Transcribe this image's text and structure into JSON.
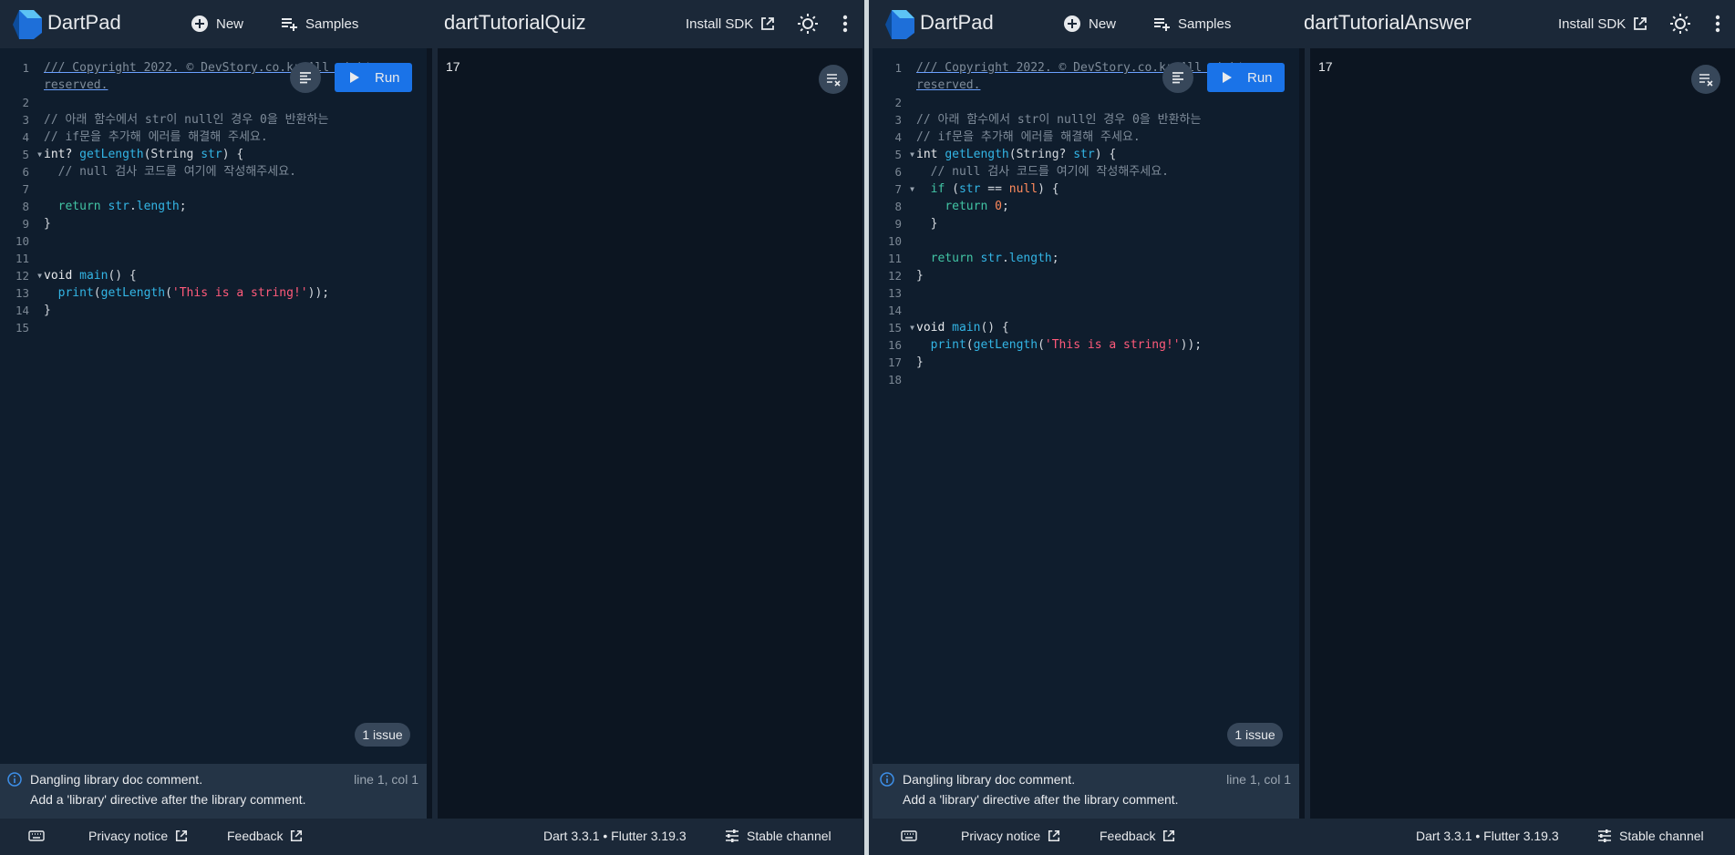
{
  "colors": {
    "accent": "#1a73e8",
    "background": "#0c1521",
    "toolbar": "#1b2838",
    "editor": "#0f1d2d"
  },
  "panes": [
    {
      "brand": "DartPad",
      "new_label": "New",
      "samples_label": "Samples",
      "title": "dartTutorialQuiz",
      "install_sdk_label": "Install SDK",
      "run_label": "Run",
      "issues_label": "1 issue",
      "console_output": "17",
      "problem": {
        "message": "Dangling library doc comment.",
        "fix": "Add a 'library' directive after the library comment.",
        "location": "line 1, col 1"
      },
      "footer": {
        "privacy": "Privacy notice",
        "feedback": "Feedback",
        "version": "Dart 3.3.1 • Flutter 3.19.3",
        "channel": "Stable channel"
      },
      "code": [
        {
          "n": "1",
          "fold": false,
          "cls": "doc",
          "text": "/// Copyright 2022. © DevStory.co.kr All rights"
        },
        {
          "n": "",
          "fold": false,
          "cls": "doc",
          "text": "reserved."
        },
        {
          "n": "2",
          "fold": false,
          "cls": "",
          "text": ""
        },
        {
          "n": "3",
          "fold": false,
          "cls": "c-com",
          "text": "// 아래 함수에서 str이 null인 경우 0을 반환하는"
        },
        {
          "n": "4",
          "fold": false,
          "cls": "c-com",
          "text": "// if문을 추가해 에러를 해결해 주세요."
        },
        {
          "n": "5",
          "fold": true,
          "cls": "",
          "html": "<span class='c-kw'>int? </span><span class='c-fn'>getLength</span>(String <span class='c-id'>str</span>) {"
        },
        {
          "n": "6",
          "fold": false,
          "cls": "c-com",
          "text": "  // null 검사 코드를 여기에 작성해주세요."
        },
        {
          "n": "7",
          "fold": false,
          "cls": "",
          "text": ""
        },
        {
          "n": "8",
          "fold": false,
          "cls": "",
          "html": "  <span class='c-kw2'>return</span> <span class='c-id'>str</span>.<span class='c-id'>length</span>;"
        },
        {
          "n": "9",
          "fold": false,
          "cls": "",
          "text": "}"
        },
        {
          "n": "10",
          "fold": false,
          "cls": "",
          "text": ""
        },
        {
          "n": "11",
          "fold": false,
          "cls": "",
          "text": ""
        },
        {
          "n": "12",
          "fold": true,
          "cls": "",
          "html": "<span class='c-kw'>void</span> <span class='c-fn'>main</span>() {"
        },
        {
          "n": "13",
          "fold": false,
          "cls": "",
          "html": "  <span class='c-fn'>print</span>(<span class='c-fn'>getLength</span>(<span class='c-str'>'This is a string!'</span>));"
        },
        {
          "n": "14",
          "fold": false,
          "cls": "",
          "text": "}"
        },
        {
          "n": "15",
          "fold": false,
          "cls": "",
          "text": ""
        }
      ]
    },
    {
      "brand": "DartPad",
      "new_label": "New",
      "samples_label": "Samples",
      "title": "dartTutorialAnswer",
      "install_sdk_label": "Install SDK",
      "run_label": "Run",
      "issues_label": "1 issue",
      "console_output": "17",
      "problem": {
        "message": "Dangling library doc comment.",
        "fix": "Add a 'library' directive after the library comment.",
        "location": "line 1, col 1"
      },
      "footer": {
        "privacy": "Privacy notice",
        "feedback": "Feedback",
        "version": "Dart 3.3.1 • Flutter 3.19.3",
        "channel": "Stable channel"
      },
      "code": [
        {
          "n": "1",
          "fold": false,
          "cls": "doc",
          "text": "/// Copyright 2022. © DevStory.co.kr All rights"
        },
        {
          "n": "",
          "fold": false,
          "cls": "doc",
          "text": "reserved."
        },
        {
          "n": "2",
          "fold": false,
          "cls": "",
          "text": ""
        },
        {
          "n": "3",
          "fold": false,
          "cls": "c-com",
          "text": "// 아래 함수에서 str이 null인 경우 0을 반환하는"
        },
        {
          "n": "4",
          "fold": false,
          "cls": "c-com",
          "text": "// if문을 추가해 에러를 해결해 주세요."
        },
        {
          "n": "5",
          "fold": true,
          "cls": "",
          "html": "<span class='c-kw'>int</span> <span class='c-fn'>getLength</span>(String? <span class='c-id'>str</span>) {"
        },
        {
          "n": "6",
          "fold": false,
          "cls": "c-com",
          "text": "  // null 검사 코드를 여기에 작성해주세요."
        },
        {
          "n": "7",
          "fold": true,
          "cls": "",
          "html": "  <span class='c-kw2'>if</span> (<span class='c-id'>str</span> == <span class='c-num'>null</span>) {"
        },
        {
          "n": "8",
          "fold": false,
          "cls": "",
          "html": "    <span class='c-kw2'>return</span> <span class='c-num'>0</span>;"
        },
        {
          "n": "9",
          "fold": false,
          "cls": "",
          "text": "  }"
        },
        {
          "n": "10",
          "fold": false,
          "cls": "",
          "text": ""
        },
        {
          "n": "11",
          "fold": false,
          "cls": "",
          "html": "  <span class='c-kw2'>return</span> <span class='c-id'>str</span>.<span class='c-id'>length</span>;"
        },
        {
          "n": "12",
          "fold": false,
          "cls": "",
          "text": "}"
        },
        {
          "n": "13",
          "fold": false,
          "cls": "",
          "text": ""
        },
        {
          "n": "14",
          "fold": false,
          "cls": "",
          "text": ""
        },
        {
          "n": "15",
          "fold": true,
          "cls": "",
          "html": "<span class='c-kw'>void</span> <span class='c-fn'>main</span>() {"
        },
        {
          "n": "16",
          "fold": false,
          "cls": "",
          "html": "  <span class='c-fn'>print</span>(<span class='c-fn'>getLength</span>(<span class='c-str'>'This is a string!'</span>));"
        },
        {
          "n": "17",
          "fold": false,
          "cls": "",
          "text": "}"
        },
        {
          "n": "18",
          "fold": false,
          "cls": "",
          "text": ""
        }
      ]
    }
  ]
}
